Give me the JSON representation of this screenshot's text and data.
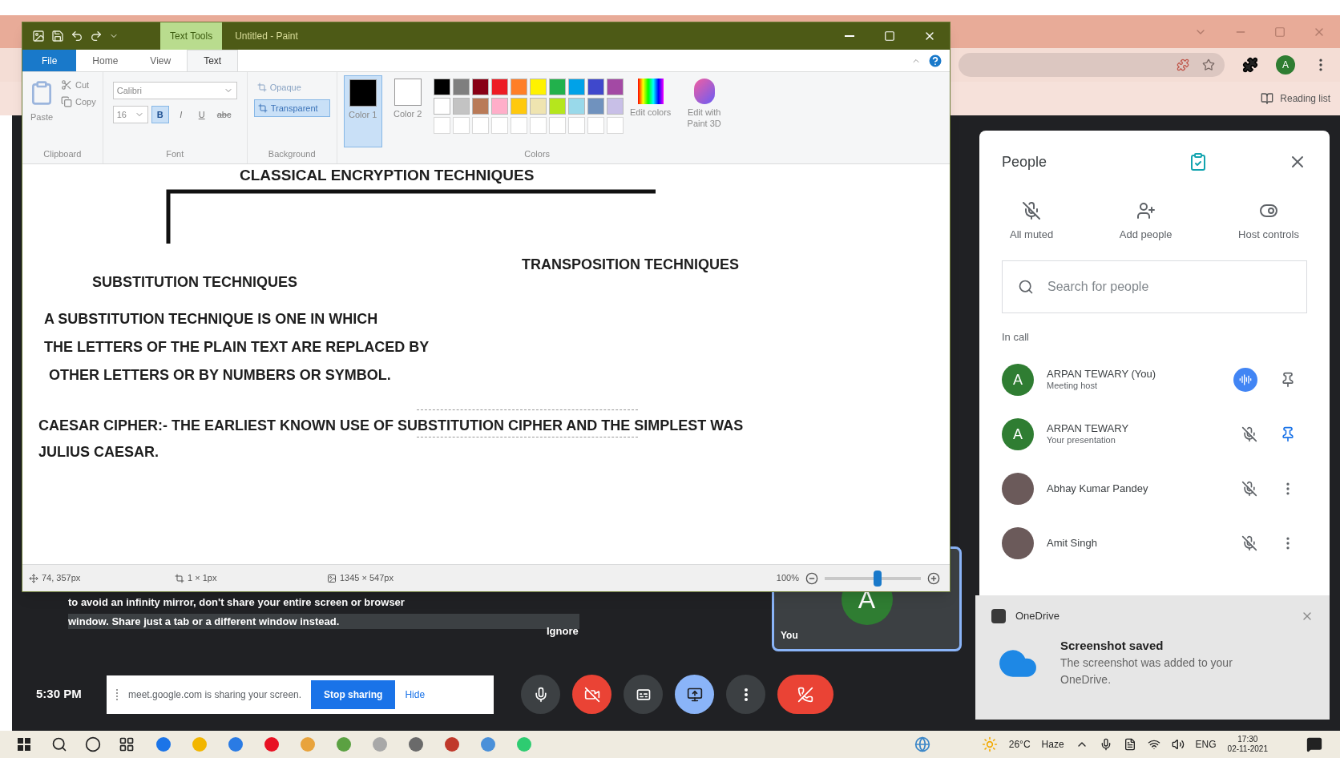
{
  "chrome": {
    "bookmark": "Reading list",
    "profile_initial": "A"
  },
  "paint": {
    "context_tab": "Text Tools",
    "title": "Untitled - Paint",
    "tabs": [
      {
        "label": "File",
        "kind": "file",
        "selected": false
      },
      {
        "label": "Home",
        "kind": "tab",
        "selected": false
      },
      {
        "label": "View",
        "kind": "tab",
        "selected": false
      },
      {
        "label": "Text",
        "kind": "tab",
        "selected": true
      }
    ],
    "clipboard": {
      "paste": "Paste",
      "cut": "Cut",
      "copy": "Copy",
      "group": "Clipboard"
    },
    "font": {
      "family": "Calibri",
      "size": "16",
      "group": "Font",
      "styles": [
        {
          "label": "B",
          "selected": true
        },
        {
          "label": "I",
          "selected": false
        },
        {
          "label": "U",
          "selected": false
        },
        {
          "label": "abc",
          "selected": false
        }
      ]
    },
    "background": {
      "group": "Background",
      "options": [
        {
          "label": "Opaque",
          "selected": false
        },
        {
          "label": "Transparent",
          "selected": true
        }
      ]
    },
    "colors": {
      "group": "Colors",
      "edit": "Edit colors",
      "paint3d": "Edit with Paint 3D",
      "slots": [
        {
          "label": "Color 1",
          "color": "#000000",
          "selected": true
        },
        {
          "label": "Color 2",
          "color": "#ffffff",
          "selected": false
        }
      ],
      "palette": [
        {
          "color": "#000000"
        },
        {
          "color": "#7f7f7f"
        },
        {
          "color": "#880015"
        },
        {
          "color": "#ed1c24"
        },
        {
          "color": "#ff7f27"
        },
        {
          "color": "#fff200"
        },
        {
          "color": "#22b14c"
        },
        {
          "color": "#00a2e8"
        },
        {
          "color": "#3f48cc"
        },
        {
          "color": "#a349a4"
        },
        {
          "color": "#ffffff"
        },
        {
          "color": "#c3c3c3"
        },
        {
          "color": "#b97a57"
        },
        {
          "color": "#ffaec9"
        },
        {
          "color": "#ffc90e"
        },
        {
          "color": "#efe4b0"
        },
        {
          "color": "#b5e61d"
        },
        {
          "color": "#99d9ea"
        },
        {
          "color": "#7092be"
        },
        {
          "color": "#c8bfe7"
        }
      ]
    },
    "canvas": {
      "title": "CLASSICAL ENCRYPTION TECHNIQUES",
      "left_heading": "SUBSTITUTION TECHNIQUES",
      "right_heading": "TRANSPOSITION TECHNIQUES",
      "paragraph": [
        "A SUBSTITUTION TECHNIQUE IS ONE IN WHICH",
        "THE LETTERS OF THE PLAIN TEXT ARE REPLACED BY",
        "OTHER LETTERS OR BY NUMBERS OR SYMBOL."
      ],
      "caesar": [
        "CAESAR CIPHER:- THE EARLIEST KNOWN USE OF SUBSTITUTION CIPHER AND THE SIMPLEST WAS",
        "JULIUS CAESAR."
      ]
    },
    "status": {
      "position": "74, 357px",
      "selection": "1 × 1px",
      "size": "1345 × 547px",
      "zoom": "100%",
      "zoom_slider": {
        "level": 0.55
      }
    }
  },
  "meet": {
    "warning": [
      "to avoid an infinity mirror, don't share your entire screen or browser",
      "window. Share just a tab or a different window instead."
    ],
    "ignore": "Ignore",
    "self_tile": {
      "initial": "A",
      "label": "You"
    },
    "time": "5:30 PM",
    "share_bar": {
      "message": "meet.google.com is sharing your screen.",
      "stop": "Stop sharing",
      "hide": "Hide"
    },
    "controls": [
      {
        "kind": "mic",
        "color": "#3c4043"
      },
      {
        "kind": "camera_off",
        "color": "#ea4335"
      },
      {
        "kind": "captions",
        "color": "#3c4043"
      },
      {
        "kind": "present",
        "color": "#8ab4f8"
      },
      {
        "kind": "more",
        "color": "#3c4043"
      },
      {
        "kind": "leave",
        "color": "#ea4335"
      }
    ]
  },
  "people_panel": {
    "title": "People",
    "actions": [
      {
        "kind": "mute",
        "label": "All muted"
      },
      {
        "kind": "add",
        "label": "Add people"
      },
      {
        "kind": "host",
        "label": "Host controls"
      }
    ],
    "search": {
      "placeholder": "Search for people"
    },
    "section": "In call",
    "participants": [
      {
        "name": "ARPAN TEWARY (You)",
        "subtitle": "Meeting host",
        "avatar": {
          "kind": "letter",
          "initial": "A"
        },
        "actions": [
          {
            "kind": "audio",
            "on": true
          },
          {
            "kind": "pin",
            "on": false
          }
        ]
      },
      {
        "name": "ARPAN TEWARY",
        "subtitle": "Your presentation",
        "avatar": {
          "kind": "letter",
          "initial": "A"
        },
        "actions": [
          {
            "kind": "muted",
            "on": false
          },
          {
            "kind": "pin",
            "on": true
          }
        ]
      },
      {
        "name": "Abhay Kumar Pandey",
        "avatar": {
          "kind": "photo"
        },
        "actions": [
          {
            "kind": "muted",
            "on": false
          },
          {
            "kind": "more",
            "on": false
          }
        ]
      },
      {
        "name": "Amit Singh",
        "avatar": {
          "kind": "photo"
        },
        "actions": [
          {
            "kind": "muted",
            "on": false
          },
          {
            "kind": "more",
            "on": false
          }
        ]
      }
    ]
  },
  "toast": {
    "app": "OneDrive",
    "title": "Screenshot saved",
    "body": "The screenshot was added to your OneDrive."
  },
  "taskbar": {
    "temperature": "26°C",
    "condition": "Haze",
    "language": "ENG",
    "time": "17:30",
    "date": "02-11-2021"
  }
}
